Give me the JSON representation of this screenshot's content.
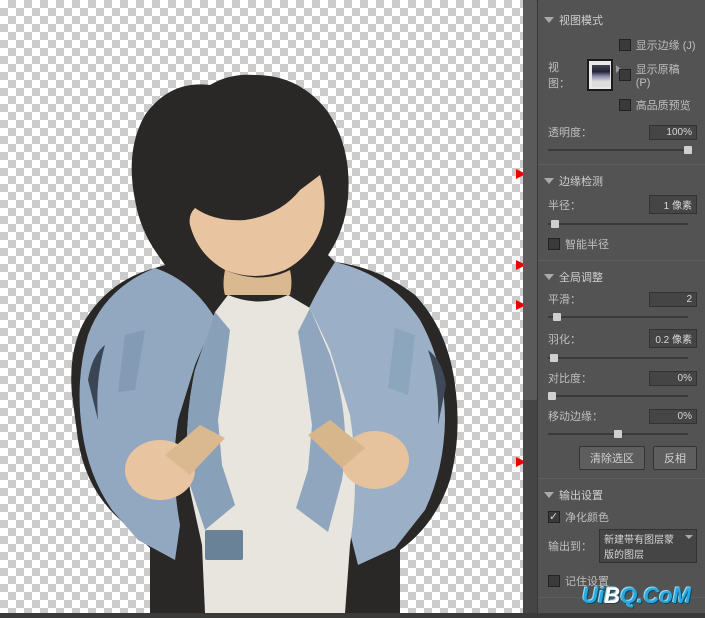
{
  "sections": {
    "viewMode": {
      "title": "视图模式",
      "viewLabel": "视图：",
      "showEdge": "显示边缘 (J)",
      "showOriginal": "显示原稿 (P)",
      "highQuality": "高品质预览"
    },
    "opacity": {
      "label": "透明度：",
      "value": "100%",
      "sliderPos": 140
    },
    "edgeDetect": {
      "title": "边缘检测",
      "radiusLabel": "半径：",
      "radiusValue": "1 像素",
      "radiusPos": 7,
      "smartRadius": "智能半径"
    },
    "globalAdjust": {
      "title": "全局调整",
      "smoothLabel": "平滑：",
      "smoothValue": "2",
      "smoothPos": 9,
      "featherLabel": "羽化：",
      "featherValue": "0.2 像素",
      "featherPos": 6,
      "contrastLabel": "对比度：",
      "contrastValue": "0%",
      "contrastPos": 4,
      "shiftLabel": "移动边缘：",
      "shiftValue": "0%",
      "shiftPos": 70,
      "clearSel": "清除选区",
      "invert": "反相"
    },
    "output": {
      "title": "输出设置",
      "decontam": "净化颜色",
      "outputTo": "输出到：",
      "outputVal": "新建带有图层蒙版的图层",
      "remember": "记住设置"
    }
  },
  "watermark": {
    "u": "U",
    "i": "i",
    "b": "B",
    "q": "Q",
    "dot": ".",
    "c": "C",
    "o": "o",
    "m": "M"
  }
}
